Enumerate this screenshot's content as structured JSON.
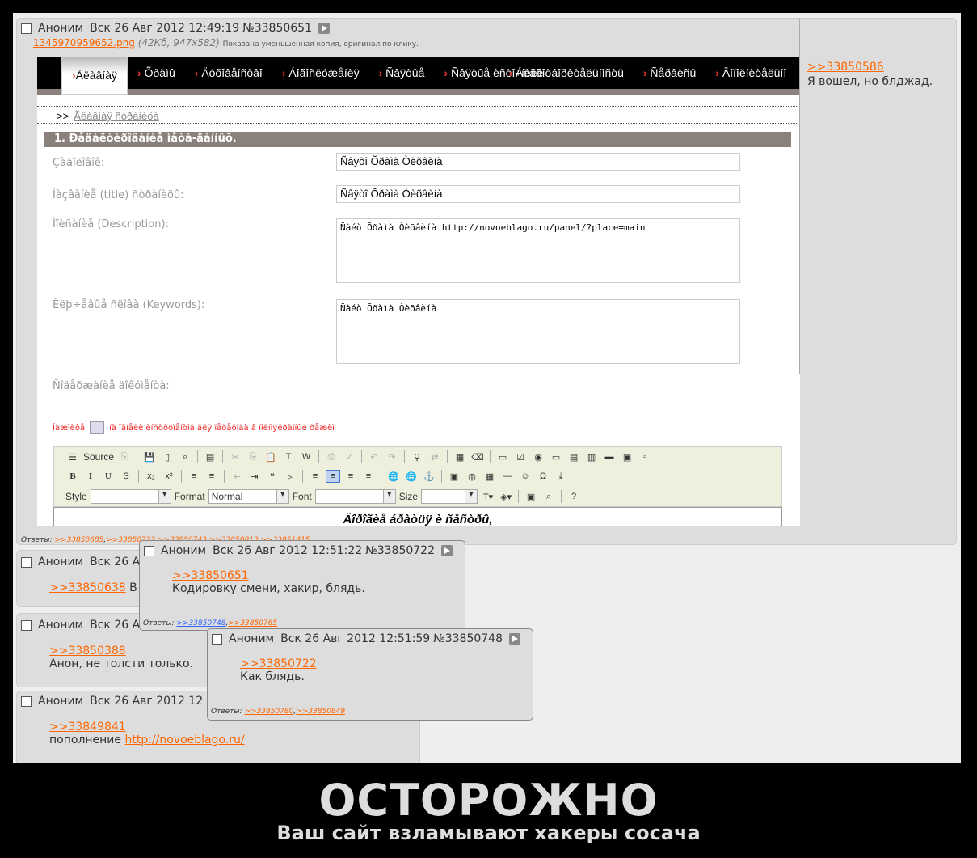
{
  "op": {
    "checkbox": "",
    "author": "Аноним",
    "date": "Вск 26 Авг 2012 12:49:19",
    "num": "№33850651",
    "file_name": "1345970959652.png",
    "file_meta": "(42Кб, 947x582)",
    "file_note": "Показана уменьшенная копия, оригинал по клику.",
    "replies_label": "Ответы:",
    "replies": [
      ">>33850685",
      ">>33850722",
      ">>33850743",
      ">>33850813",
      ">>33851415"
    ],
    "side_link": ">>33850586",
    "side_text": "Я вошел, но блджад."
  },
  "shot": {
    "nav": [
      "Ãëàâíàÿ",
      "Õðàìû",
      "Äóõîâåíñòâî",
      "Áîãîñëóæåíèÿ",
      "Ñâÿòûå",
      "Ñâÿòûå èñòî÷íèêè",
      "Áëàãîòâîðèòåëüíîñòü",
      "Ñåðâèñû",
      "Äîïîëíèòåëüíî"
    ],
    "crumb_prefix": ">>",
    "crumb": "Ãëàâíàÿ ñòðàíèöà",
    "section": "1. Ðåäàêòèðîâàíèå ìåòà-äàííûõ.",
    "fields": [
      {
        "label": "Çàãîëîâîê:",
        "value": "Ñâÿòî Õðàìà Òèõâèíà"
      },
      {
        "label": "Íàçâàíèå (title) ñòðàíèöû:",
        "value": "Ñâÿòî Õðàìà Òèõâèíà"
      },
      {
        "label": "Îïèñàíèå (Description):",
        "value": "Ñàéò Õðàìà Òèõâèíà http://novoeblago.ru/panel/?place=main"
      },
      {
        "label": "Êëþ÷åâûå ñëîâà (Keywords):",
        "value": "Ñàéò Õðàìà Òèõâèíà"
      }
    ],
    "content_label": "Ñîäåðæàíèå äîêóìåíòà:",
    "hint_before": "Íàæìèòå",
    "hint_after": "íà ïàíåëè èíñòðóìåíòîâ äëÿ ïåðåõîäà â ïîëíîýêðàííûé ðåæèì",
    "toolbar": {
      "source": "Source",
      "style": "Style",
      "format": "Format",
      "format_value": "Normal",
      "font": "Font",
      "size": "Size"
    },
    "editor_text": "Äîðîãèå áðàòüÿ è ñåñòðû,"
  },
  "popup1": {
    "author": "Аноним",
    "date": "Вск 26 Авг 2012 12:51:22",
    "num": "№33850722",
    "link": ">>33850651",
    "text": "Кодировку смени, хакир, блядь.",
    "replies_label": "Ответы:",
    "replies": [
      ">>33850748",
      ">>33850765"
    ]
  },
  "popup2": {
    "author": "Аноним",
    "date": "Вск 26 Авг 2012 12:51:59",
    "num": "№33850748",
    "link": ">>33850722",
    "text": "Как блядь.",
    "replies_label": "Ответы:",
    "replies": [
      ">>33850780",
      ">>33850849"
    ]
  },
  "post2": {
    "author": "Аноним",
    "date": "Вск 26 А",
    "link": ">>33850638",
    "text": "Вт"
  },
  "post3": {
    "author": "Аноним",
    "date": "Вск 26 А",
    "link": ">>33850388",
    "text": "Анон, не толсти только."
  },
  "post4": {
    "author": "Аноним",
    "date": "Вск 26 Авг 2012 12",
    "link": ">>33849841",
    "text": "пополнение",
    "url": "http://novoeblago.ru/"
  },
  "caption": {
    "title": "ОСТОРОЖНО",
    "subtitle": "Ваш сайт взламывают хакеры сосача"
  }
}
